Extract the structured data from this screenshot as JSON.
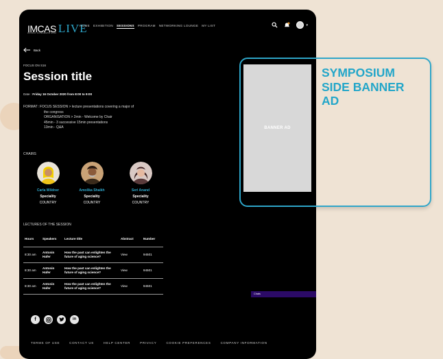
{
  "header": {
    "logo_text": "IMCAS",
    "logo_accent": "LIVE",
    "logo_subtext": "WORLD CONGRESS 2020",
    "nav": [
      "HOME",
      "EXHIBITION",
      "SESSIONS",
      "PROGRAM",
      "NETWORKING LOUNGE",
      "MY LIST"
    ],
    "active_nav": "SESSIONS"
  },
  "back_label": "Back",
  "session": {
    "focus_label": "FOCUS ON S16",
    "title": "Session title",
    "date_label": "Date :",
    "date_value": "Friday 16 October 2020 from 8:00 to 9:00",
    "format_label": "FORMAT :",
    "format_lines": [
      "FOCUS SESSION > lecture presentations covering a major of",
      "the congress",
      "ORGANISATION > 2min - Welcome by Chair",
      "45min - 3 successive 15min presentations",
      "13min - Q&A"
    ]
  },
  "chairs_label": "CHAIRS",
  "chairs": [
    {
      "name": "Carla Wildner",
      "speciality": "Speciality",
      "country": "COUNTRY"
    },
    {
      "name": "Amolika Shaikh",
      "speciality": "Speciality",
      "country": "COUNTRY"
    },
    {
      "name": "Seri Anand",
      "speciality": "Speciality",
      "country": "COUNTRY"
    }
  ],
  "lectures_label": "LECTURES OF THE SESSION",
  "lectures_headers": [
    "Hours",
    "Speakers",
    "Lecture title",
    "Abstract",
    "Number"
  ],
  "lectures": [
    {
      "hours": "8:30 am",
      "speaker": "Antonin Hafer",
      "title": "How the past can enlighten the future of aging science?",
      "abstract": "View",
      "number": "94501"
    },
    {
      "hours": "8:30 am",
      "speaker": "Antonin Hafer",
      "title": "How the past can enlighten the future of aging science?",
      "abstract": "View",
      "number": "94501"
    },
    {
      "hours": "8:30 am",
      "speaker": "Antonin Hafer",
      "title": "How the past can enlighten the future of aging science?",
      "abstract": "View",
      "number": "94501"
    }
  ],
  "chats_label": "Chats",
  "socials": [
    "facebook-icon",
    "instagram-icon",
    "twitter-icon",
    "linkedin-icon"
  ],
  "footer": [
    "TERMS OF USE",
    "CONTACT US",
    "HELP CENTER",
    "PRIVACY",
    "COOKIE PREFERENCES",
    "COMPANY INFORMATION"
  ],
  "ad": {
    "banner_label": "BANNER AD",
    "title": "SYMPOSIUM SIDE BANNER AD"
  },
  "colors": {
    "accent": "#2ea6c9",
    "background": "#efe3d4",
    "frame": "#000000",
    "chats_bar": "#2b0a66"
  }
}
